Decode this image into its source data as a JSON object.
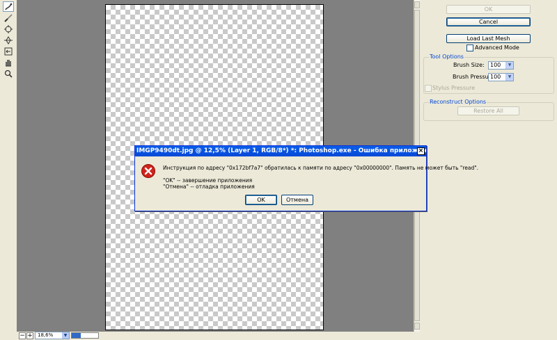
{
  "statusbar": {
    "zoom_value": "18,6%",
    "zoom_out": "−",
    "zoom_in": "+",
    "progress_percent": 35
  },
  "panel": {
    "ok_label": "OK",
    "cancel_label": "Cancel",
    "load_mesh_label": "Load Last Mesh",
    "advanced_mode_label": "Advanced Mode",
    "tool_options": {
      "title": "Tool Options",
      "brush_size_label": "Brush Size:",
      "brush_size_value": "100",
      "brush_pressure_label": "Brush Pressure:",
      "brush_pressure_value": "100",
      "stylus_pressure_label": "Stylus Pressure"
    },
    "reconstruct_options": {
      "title": "Reconstruct Options",
      "restore_all_label": "Restore All"
    }
  },
  "dialog": {
    "title": "IMGP9490dt.jpg @ 12,5% (Layer 1, RGB/8*) *: Photoshop.exe - Ошибка приложения",
    "close_glyph": "×",
    "message_line1": "Инструкция по адресу \"0x172bf7a7\" обратилась к памяти по адресу \"0x00000000\". Память не может быть \"read\".",
    "message_line2": "\"OK\" -- завершение приложения",
    "message_line3": "\"Отмена\" -- отладка приложения",
    "ok_label": "OK",
    "cancel_label": "Отмена"
  }
}
